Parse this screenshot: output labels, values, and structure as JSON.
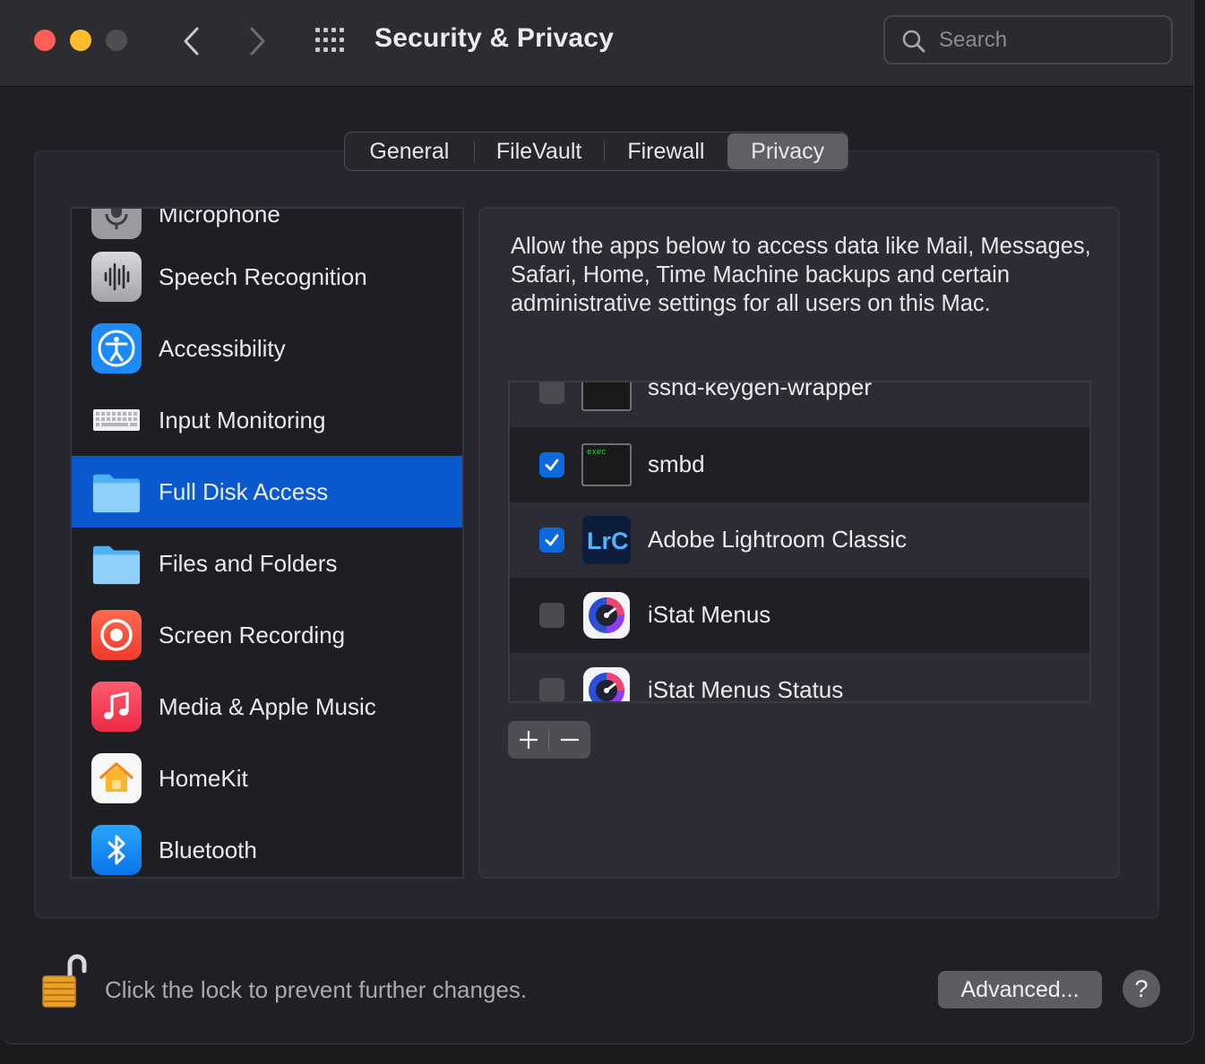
{
  "window": {
    "title": "Security & Privacy",
    "search_placeholder": "Search"
  },
  "tabs": [
    {
      "label": "General",
      "selected": false
    },
    {
      "label": "FileVault",
      "selected": false
    },
    {
      "label": "Firewall",
      "selected": false
    },
    {
      "label": "Privacy",
      "selected": true
    }
  ],
  "sidebar": {
    "items": [
      {
        "label": "Microphone",
        "icon": "microphone-icon"
      },
      {
        "label": "Speech Recognition",
        "icon": "waveform-icon"
      },
      {
        "label": "Accessibility",
        "icon": "accessibility-icon"
      },
      {
        "label": "Input Monitoring",
        "icon": "keyboard-icon"
      },
      {
        "label": "Full Disk Access",
        "icon": "folder-icon",
        "selected": true
      },
      {
        "label": "Files and Folders",
        "icon": "folder-icon"
      },
      {
        "label": "Screen Recording",
        "icon": "screen-recording-icon"
      },
      {
        "label": "Media & Apple Music",
        "icon": "music-icon"
      },
      {
        "label": "HomeKit",
        "icon": "home-icon"
      },
      {
        "label": "Bluetooth",
        "icon": "bluetooth-icon"
      }
    ]
  },
  "panel": {
    "description": "Allow the apps below to access data like Mail, Messages, Safari, Home, Time Machine backups and certain administrative settings for all users on this Mac.",
    "apps": [
      {
        "label": "sshd-keygen-wrapper",
        "checked": false,
        "icon": "terminal-exec-icon"
      },
      {
        "label": "smbd",
        "checked": true,
        "icon": "terminal-exec-icon",
        "icon_text": "exec"
      },
      {
        "label": "Adobe Lightroom Classic",
        "checked": true,
        "icon": "lightroom-icon",
        "icon_text": "LrC"
      },
      {
        "label": "iStat Menus",
        "checked": false,
        "icon": "istat-icon"
      },
      {
        "label": "iStat Menus Status",
        "checked": false,
        "icon": "istat-icon"
      }
    ],
    "add_label": "+",
    "remove_label": "−"
  },
  "footer": {
    "lock_text": "Click the lock to prevent further changes.",
    "advanced_label": "Advanced...",
    "help_label": "?"
  },
  "colors": {
    "selection": "#0a59cf",
    "checkbox_on": "#0b6bde",
    "traffic_red": "#fe5f57",
    "traffic_yellow": "#febc2e"
  }
}
